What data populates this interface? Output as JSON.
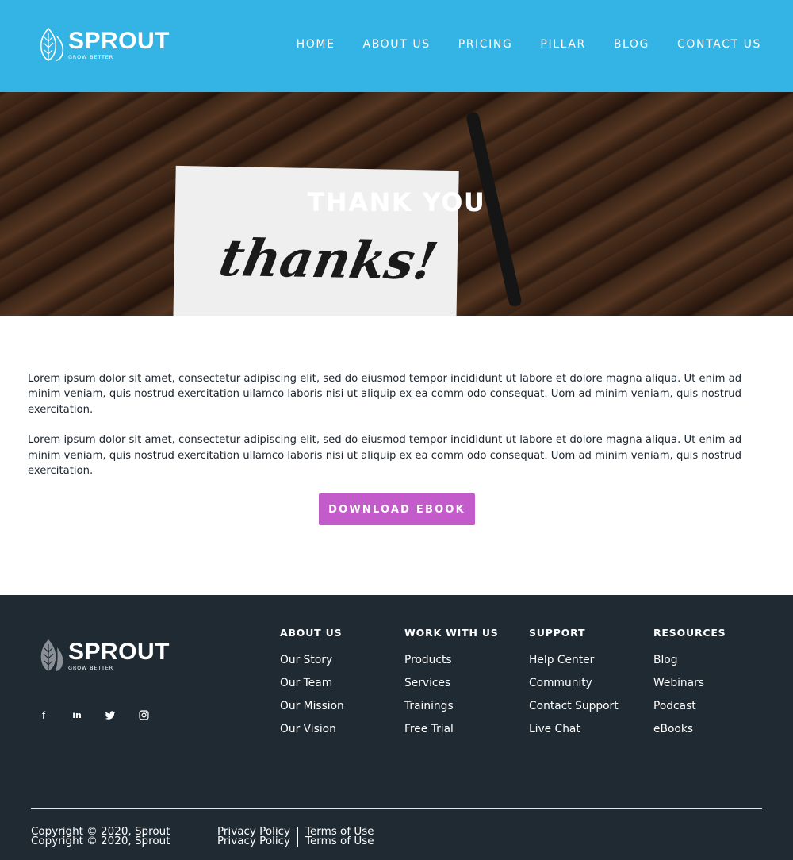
{
  "brand": {
    "name": "SPROUT",
    "tagline": "GROW BETTER",
    "logo_icon": "leaf-icon",
    "primary_color": "#33b4e5",
    "button_color": "#c35bcb",
    "footer_color": "#1f2a33"
  },
  "nav": {
    "items": [
      "HOME",
      "ABOUT US",
      "PRICING",
      "PILLAR",
      "BLOG",
      "CONTACT US"
    ]
  },
  "hero": {
    "title": "THANK YOU",
    "card_text": "thanks!"
  },
  "content": {
    "paragraphs": [
      "Lorem ipsum dolor sit amet, consectetur adipiscing elit, sed do eiusmod tempor incididunt ut labore et dolore magna aliqua. Ut enim ad minim veniam, quis nostrud exercitation ullamco laboris nisi ut aliquip ex ea comm odo consequat. Uom ad minim veniam, quis nostrud exercitation.",
      "Lorem ipsum dolor sit amet, consectetur adipiscing elit, sed do eiusmod tempor incididunt ut labore et dolore magna aliqua. Ut enim ad minim veniam, quis nostrud exercitation ullamco laboris nisi ut aliquip ex ea comm odo consequat. Uom ad minim veniam, quis nostrud exercitation."
    ],
    "button_label": "DOWNLOAD EBOOK"
  },
  "footer": {
    "social_icons": [
      "facebook-icon",
      "linkedin-icon",
      "twitter-icon",
      "instagram-icon"
    ],
    "columns": [
      {
        "heading": "ABOUT US",
        "links": [
          "Our Story",
          "Our Team",
          "Our Mission",
          "Our Vision"
        ]
      },
      {
        "heading": "WORK WITH US",
        "links": [
          "Products",
          "Services",
          "Trainings",
          "Free Trial"
        ]
      },
      {
        "heading": "SUPPORT",
        "links": [
          "Help Center",
          "Community",
          "Contact Support",
          "Live Chat"
        ]
      },
      {
        "heading": "RESOURCES",
        "links": [
          "Blog",
          "Webinars",
          "Podcast",
          "eBooks"
        ]
      }
    ],
    "copyright": "Copyright © 2020, Sprout",
    "privacy": "Privacy Policy",
    "terms": "Terms of Use"
  }
}
